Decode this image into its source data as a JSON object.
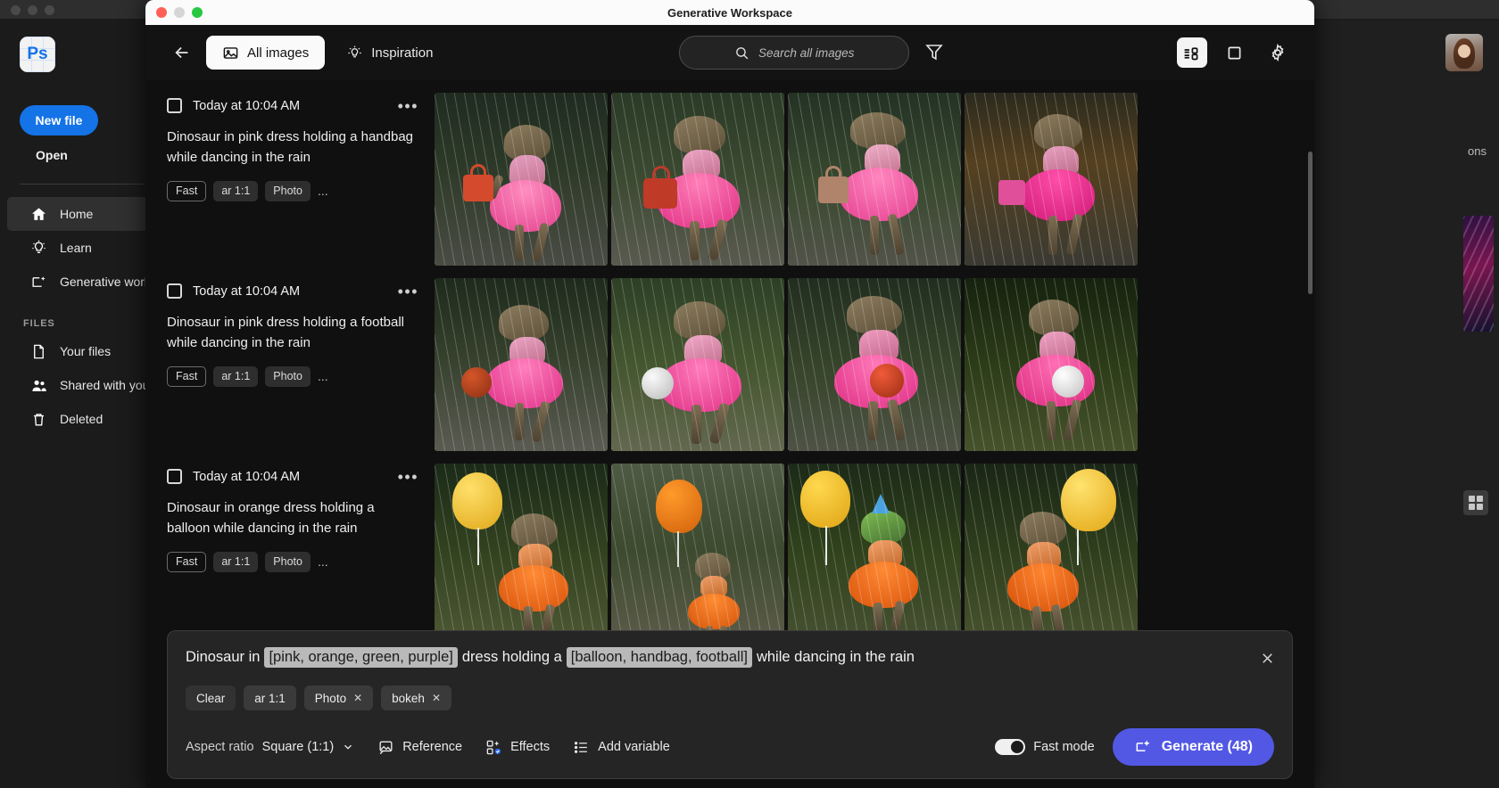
{
  "background_app": {
    "logo_text": "Ps",
    "new_file_label": "New file",
    "open_label": "Open",
    "nav_items": [
      {
        "label": "Home",
        "icon": "home-icon"
      },
      {
        "label": "Learn",
        "icon": "lightbulb-icon"
      },
      {
        "label": "Generative worl",
        "icon": "generative-icon"
      }
    ],
    "files_section_label": "FILES",
    "file_items": [
      {
        "label": "Your files",
        "icon": "document-icon"
      },
      {
        "label": "Shared with you",
        "icon": "people-icon"
      },
      {
        "label": "Deleted",
        "icon": "trash-icon"
      }
    ],
    "right_panel_text": "ons"
  },
  "window": {
    "title": "Generative Workspace"
  },
  "toolbar": {
    "back_icon": "arrow-left-icon",
    "tabs": [
      {
        "label": "All images",
        "icon": "image-icon",
        "active": true
      },
      {
        "label": "Inspiration",
        "icon": "lightbulb-icon",
        "active": false
      }
    ],
    "search": {
      "placeholder": "Search all images",
      "icon": "search-icon"
    },
    "filter_icon": "filter-icon",
    "view_icons": [
      {
        "name": "list-view-icon",
        "active": true
      },
      {
        "name": "square-view-icon",
        "active": false
      },
      {
        "name": "gear-icon",
        "active": false
      }
    ]
  },
  "results": [
    {
      "date": "Today at 10:04 AM",
      "prompt": "Dinosaur in pink dress holding a handbag while dancing in the rain",
      "tags": [
        "Fast",
        "ar 1:1",
        "Photo"
      ],
      "more_tags": "...",
      "more_menu": "•••",
      "variant": "handbag",
      "dress_color": "#f26ba8"
    },
    {
      "date": "Today at 10:04 AM",
      "prompt": "Dinosaur in pink dress holding a football while dancing in the rain",
      "tags": [
        "Fast",
        "ar 1:1",
        "Photo"
      ],
      "more_tags": "...",
      "more_menu": "•••",
      "variant": "football",
      "dress_color": "#f0509b"
    },
    {
      "date": "Today at 10:04 AM",
      "prompt": "Dinosaur in orange dress holding a balloon while dancing in the rain",
      "tags": [
        "Fast",
        "ar 1:1",
        "Photo"
      ],
      "more_tags": "...",
      "more_menu": "•••",
      "variant": "balloon",
      "dress_color": "#f36a17"
    }
  ],
  "prompt_bar": {
    "segments": [
      {
        "text": "Dinosaur in",
        "type": "text"
      },
      {
        "text": "[pink, orange, green, purple]",
        "type": "variable"
      },
      {
        "text": "dress holding a",
        "type": "text"
      },
      {
        "text": "[balloon, handbag, football]",
        "type": "variable"
      },
      {
        "text": "while dancing in the rain",
        "type": "text"
      }
    ],
    "close_icon": "close-icon",
    "chips": [
      {
        "label": "Clear",
        "removable": false
      },
      {
        "label": "ar 1:1",
        "removable": false
      },
      {
        "label": "Photo",
        "removable": true
      },
      {
        "label": "bokeh",
        "removable": true
      }
    ],
    "remove_glyph": "✕",
    "controls": {
      "aspect_ratio_label": "Aspect ratio",
      "aspect_ratio_value": "Square (1:1)",
      "reference_label": "Reference",
      "effects_label": "Effects",
      "add_variable_label": "Add variable",
      "fast_mode_label": "Fast mode",
      "fast_mode_on": true,
      "generate_label": "Generate (48)"
    }
  },
  "colors": {
    "accent_blue": "#1473e6",
    "generate_purple": "#5258e4",
    "window_bg": "#101010",
    "panel_bg": "#252525"
  }
}
